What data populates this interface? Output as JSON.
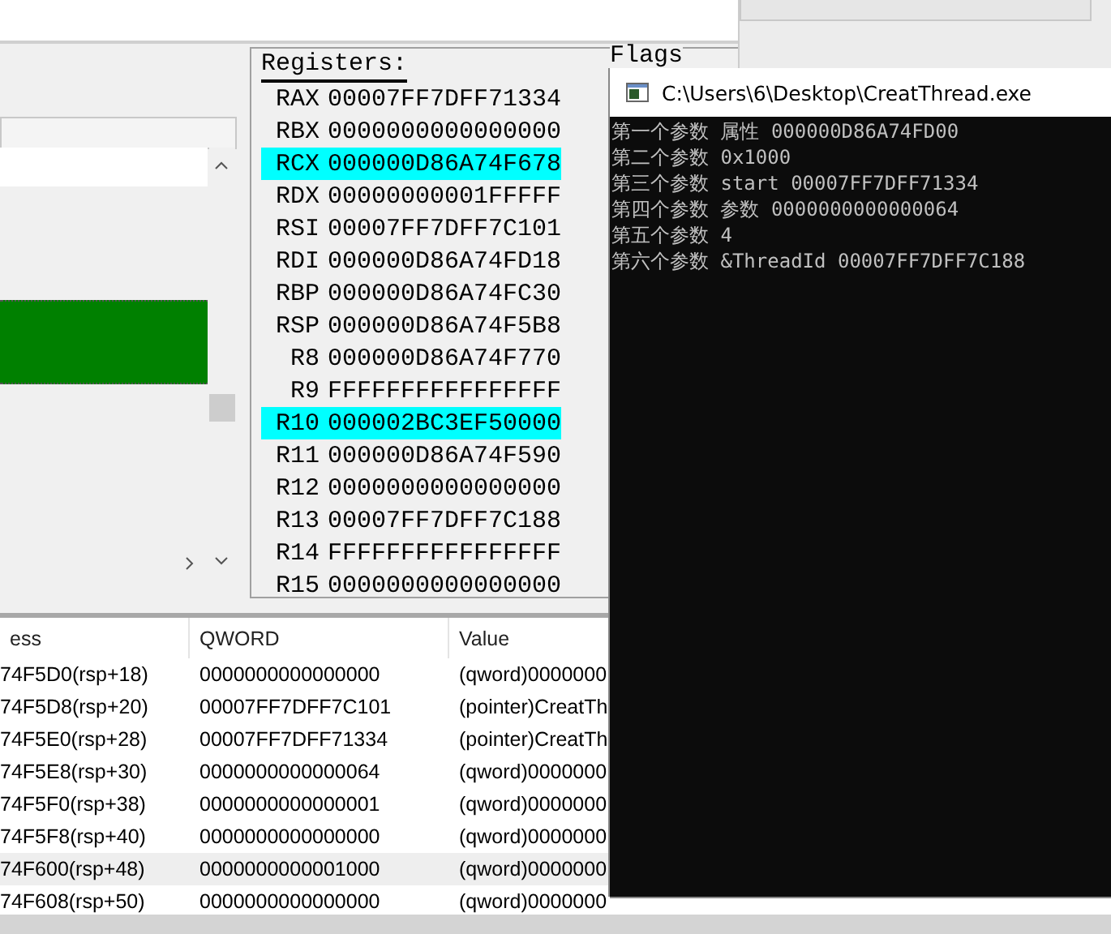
{
  "registers": {
    "title": "Registers:",
    "rows": [
      {
        "name": "RAX",
        "value": "00007FF7DFF71334",
        "highlighted": false
      },
      {
        "name": "RBX",
        "value": "0000000000000000",
        "highlighted": false
      },
      {
        "name": "RCX",
        "value": "000000D86A74F678",
        "highlighted": true
      },
      {
        "name": "RDX",
        "value": "00000000001FFFFF",
        "highlighted": false
      },
      {
        "name": "RSI",
        "value": "00007FF7DFF7C101",
        "highlighted": false
      },
      {
        "name": "RDI",
        "value": "000000D86A74FD18",
        "highlighted": false
      },
      {
        "name": "RBP",
        "value": "000000D86A74FC30",
        "highlighted": false
      },
      {
        "name": "RSP",
        "value": "000000D86A74F5B8",
        "highlighted": false
      },
      {
        "name": "R8",
        "value": "000000D86A74F770",
        "highlighted": false
      },
      {
        "name": "R9",
        "value": "FFFFFFFFFFFFFFFF",
        "highlighted": false
      },
      {
        "name": "R10",
        "value": "000002BC3EF50000",
        "highlighted": true
      },
      {
        "name": "R11",
        "value": "000000D86A74F590",
        "highlighted": false
      },
      {
        "name": "R12",
        "value": "0000000000000000",
        "highlighted": false
      },
      {
        "name": "R13",
        "value": "00007FF7DFF7C188",
        "highlighted": false
      },
      {
        "name": "R14",
        "value": "FFFFFFFFFFFFFFFF",
        "highlighted": false
      },
      {
        "name": "R15",
        "value": "0000000000000000",
        "highlighted": false
      }
    ]
  },
  "flags": {
    "title": "Flags"
  },
  "stack": {
    "columns": [
      "ess",
      "QWORD",
      "Value"
    ],
    "rows": [
      {
        "address": "74F5D0(rsp+18)",
        "qword": "0000000000000000",
        "value": "(qword)0000000",
        "selected": false
      },
      {
        "address": "74F5D8(rsp+20)",
        "qword": "00007FF7DFF7C101",
        "value": "(pointer)CreatTh",
        "selected": false
      },
      {
        "address": "74F5E0(rsp+28)",
        "qword": "00007FF7DFF71334",
        "value": "(pointer)CreatTh",
        "selected": false
      },
      {
        "address": "74F5E8(rsp+30)",
        "qword": "0000000000000064",
        "value": "(qword)0000000",
        "selected": false
      },
      {
        "address": "74F5F0(rsp+38)",
        "qword": "0000000000000001",
        "value": "(qword)0000000",
        "selected": false
      },
      {
        "address": "74F5F8(rsp+40)",
        "qword": "0000000000000000",
        "value": "(qword)0000000",
        "selected": false
      },
      {
        "address": "74F600(rsp+48)",
        "qword": "0000000000001000",
        "value": "(qword)0000000",
        "selected": true
      },
      {
        "address": "74F608(rsp+50)",
        "qword": "0000000000000000",
        "value": "(qword)0000000",
        "selected": false
      }
    ]
  },
  "console": {
    "title": "C:\\Users\\6\\Desktop\\CreatThread.exe",
    "lines": [
      "第一个参数 属性 000000D86A74FD00",
      "第二个参数 0x1000",
      "第三个参数 start 00007FF7DFF71334",
      "第四个参数 参数 0000000000000064",
      "第五个参数 4",
      "第六个参数 &ThreadId 00007FF7DFF7C188"
    ]
  }
}
